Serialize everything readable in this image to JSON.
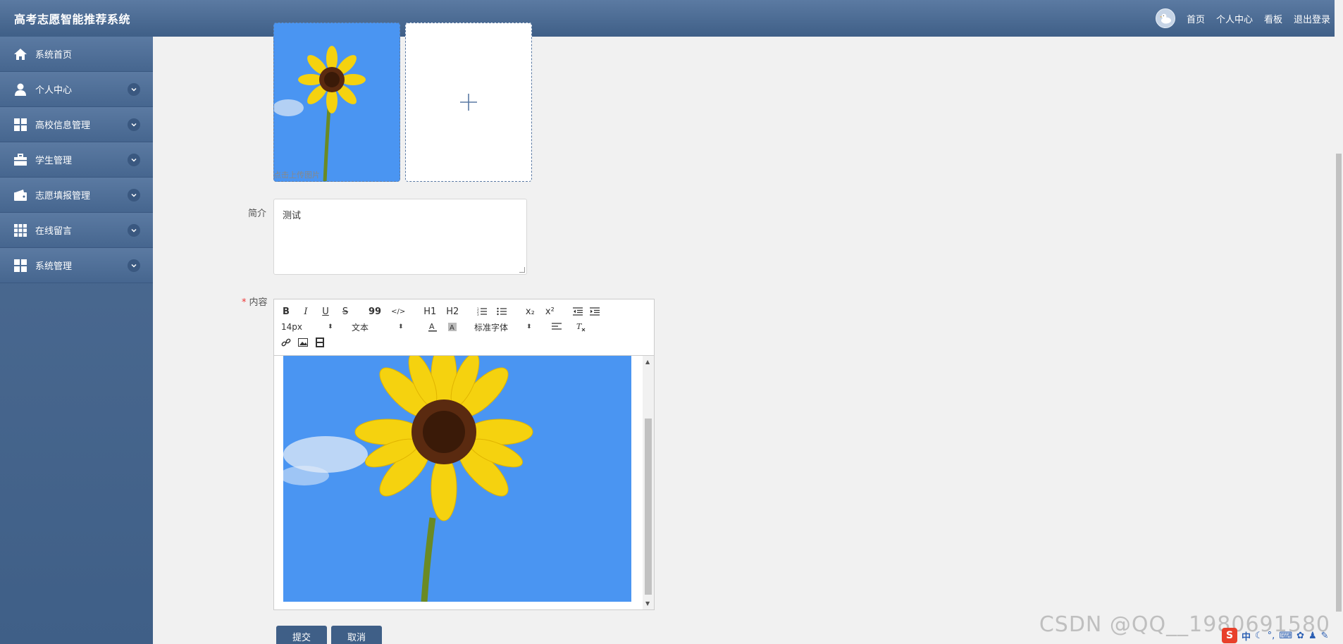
{
  "header": {
    "app_title": "高考志愿智能推荐系统",
    "links": [
      "首页",
      "个人中心",
      "看板",
      "退出登录"
    ]
  },
  "sidebar": {
    "items": [
      {
        "label": "系统首页",
        "icon": "home-icon",
        "expandable": false
      },
      {
        "label": "个人中心",
        "icon": "user-icon",
        "expandable": true
      },
      {
        "label": "高校信息管理",
        "icon": "grid-icon",
        "expandable": true
      },
      {
        "label": "学生管理",
        "icon": "briefcase-icon",
        "expandable": true
      },
      {
        "label": "志愿填报管理",
        "icon": "wallet-icon",
        "expandable": true
      },
      {
        "label": "在线留言",
        "icon": "apps-icon",
        "expandable": true
      },
      {
        "label": "系统管理",
        "icon": "grid-icon",
        "expandable": true
      }
    ]
  },
  "form": {
    "upload_hint": "点击上传图片",
    "intro_label": "简介",
    "intro_value": "测试",
    "content_label": "内容",
    "content_required_mark": "*"
  },
  "editor": {
    "toolbar_row1": [
      "B",
      "I",
      "U",
      "S",
      "99",
      "</>",
      "H1",
      "H2",
      "ol",
      "ul",
      "x₂",
      "x²",
      "outdent",
      "indent"
    ],
    "font_size": "14px",
    "paragraph": "文本",
    "font_family": "标准字体"
  },
  "buttons": {
    "submit": "提交",
    "cancel": "取消"
  },
  "watermark": "CSDN @QQ__1980691580",
  "tray": {
    "ime_label": "中"
  },
  "colors": {
    "brand": "#3f5f87",
    "sidebar": "#4f6d94",
    "background": "#f1f1f1"
  }
}
